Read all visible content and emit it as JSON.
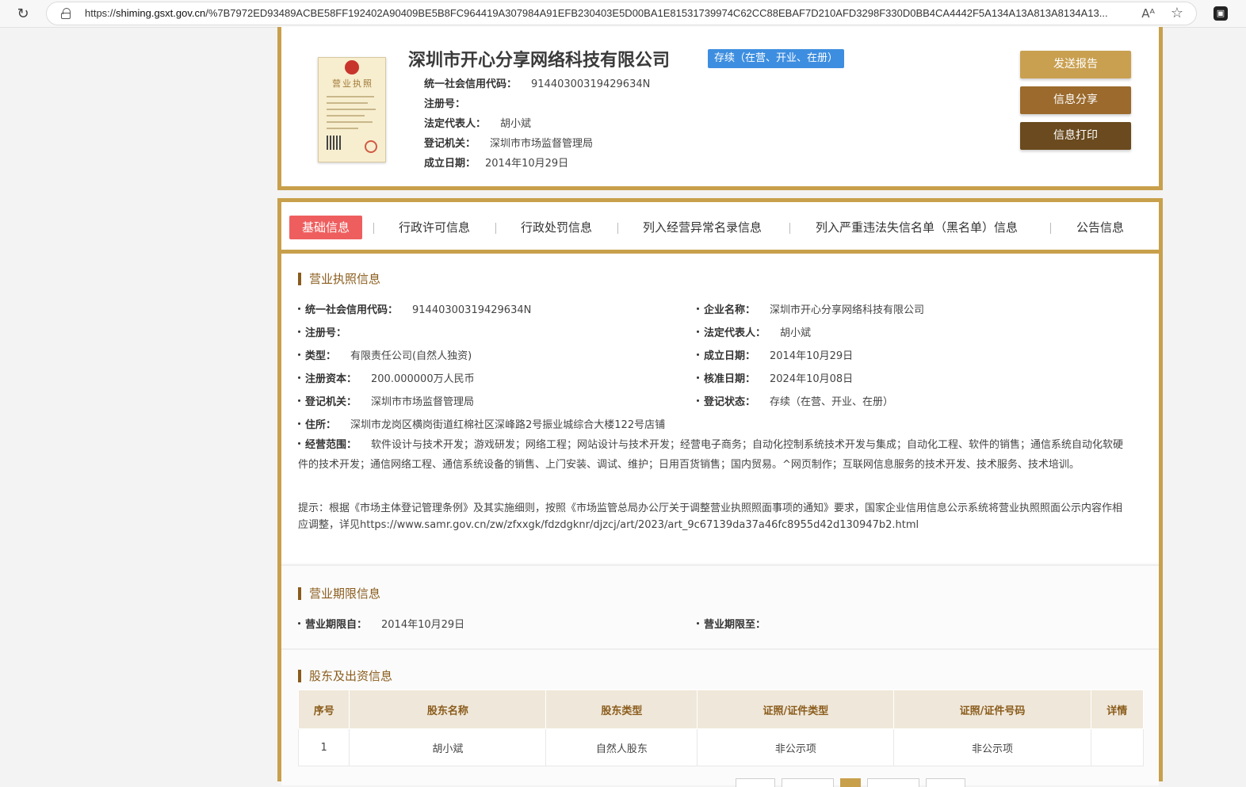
{
  "browser": {
    "url_prefix": "https://",
    "url_host": "shiming.gsxt.gov.cn",
    "url_rest": "/%7B7972ED93489ACBE58FF192402A90409BE5B8FC964419A307984A91EFB230403E5D00BA1E81531739974C62CC88EBAF7D210AFD3298F330D0BB4CA4442F5A134A13A813A8134A13...",
    "read_aloud_label": "Aᴬ"
  },
  "header": {
    "license_title": "营业执照",
    "company_name": "深圳市开心分享网络科技有限公司",
    "status": "存续（在营、开业、在册）",
    "fields": [
      {
        "key": "统一社会信用代码：",
        "value": "91440300319429634N"
      },
      {
        "key": "注册号：",
        "value": ""
      },
      {
        "key": "法定代表人：",
        "value": "胡小斌"
      },
      {
        "key": "登记机关：",
        "value": "深圳市市场监督管理局"
      },
      {
        "key": "成立日期：",
        "value": "2014年10月29日"
      }
    ],
    "buttons": {
      "send_report": "发送报告",
      "share": "信息分享",
      "print": "信息打印"
    }
  },
  "tabs": [
    "基础信息",
    "行政许可信息",
    "行政处罚信息",
    "列入经营异常名录信息",
    "列入严重违法失信名单（黑名单）信息",
    "公告信息"
  ],
  "license_section": {
    "title": "营业执照信息",
    "left": [
      {
        "key": "统一社会信用代码：",
        "value": "91440300319429634N"
      },
      {
        "key": "注册号：",
        "value": ""
      },
      {
        "key": "类型：",
        "value": "有限责任公司(自然人独资)"
      },
      {
        "key": "注册资本：",
        "value": "200.000000万人民币"
      },
      {
        "key": "登记机关：",
        "value": "深圳市市场监督管理局"
      }
    ],
    "right": [
      {
        "key": "企业名称：",
        "value": "深圳市开心分享网络科技有限公司"
      },
      {
        "key": "法定代表人：",
        "value": "胡小斌"
      },
      {
        "key": "成立日期：",
        "value": "2014年10月29日"
      },
      {
        "key": "核准日期：",
        "value": "2024年10月08日"
      },
      {
        "key": "登记状态：",
        "value": "存续（在营、开业、在册）"
      }
    ],
    "address_key": "住所：",
    "address": "深圳市龙岗区横岗街道红棉社区深峰路2号振业城综合大楼122号店铺",
    "scope_key": "经营范围：",
    "scope": "软件设计与技术开发；游戏研发；网络工程；网站设计与技术开发；经营电子商务；自动化控制系统技术开发与集成；自动化工程、软件的销售；通信系统自动化软硬件的技术开发；通信网络工程、通信系统设备的销售、上门安装、调试、维护；日用百货销售；国内贸易。^网页制作；互联网信息服务的技术开发、技术服务、技术培训。",
    "tip": "提示：根据《市场主体登记管理条例》及其实施细则，按照《市场监管总局办公厅关于调整营业执照照面事项的通知》要求，国家企业信用信息公示系统将营业执照照面公示内容作相应调整，详见https://www.samr.gov.cn/zw/zfxxgk/fdzdgknr/djzcj/art/2023/art_9c67139da37a46fc8955d42d130947b2.html"
  },
  "period_section": {
    "title": "营业期限信息",
    "from_key": "营业期限自：",
    "from_value": "2014年10月29日",
    "to_key": "营业期限至：",
    "to_value": ""
  },
  "shareholder_section": {
    "title": "股东及出资信息",
    "columns": [
      "序号",
      "股东名称",
      "股东类型",
      "证照/证件类型",
      "证照/证件号码",
      "详情"
    ],
    "rows": [
      [
        "1",
        "胡小斌",
        "自然人股东",
        "非公示项",
        "非公示项",
        ""
      ]
    ]
  },
  "colors": {
    "gold": "#c8a04c",
    "brown": "#8a5c1c",
    "active_tab": "#ef5e5e",
    "status_blue": "#3d8ee0"
  }
}
